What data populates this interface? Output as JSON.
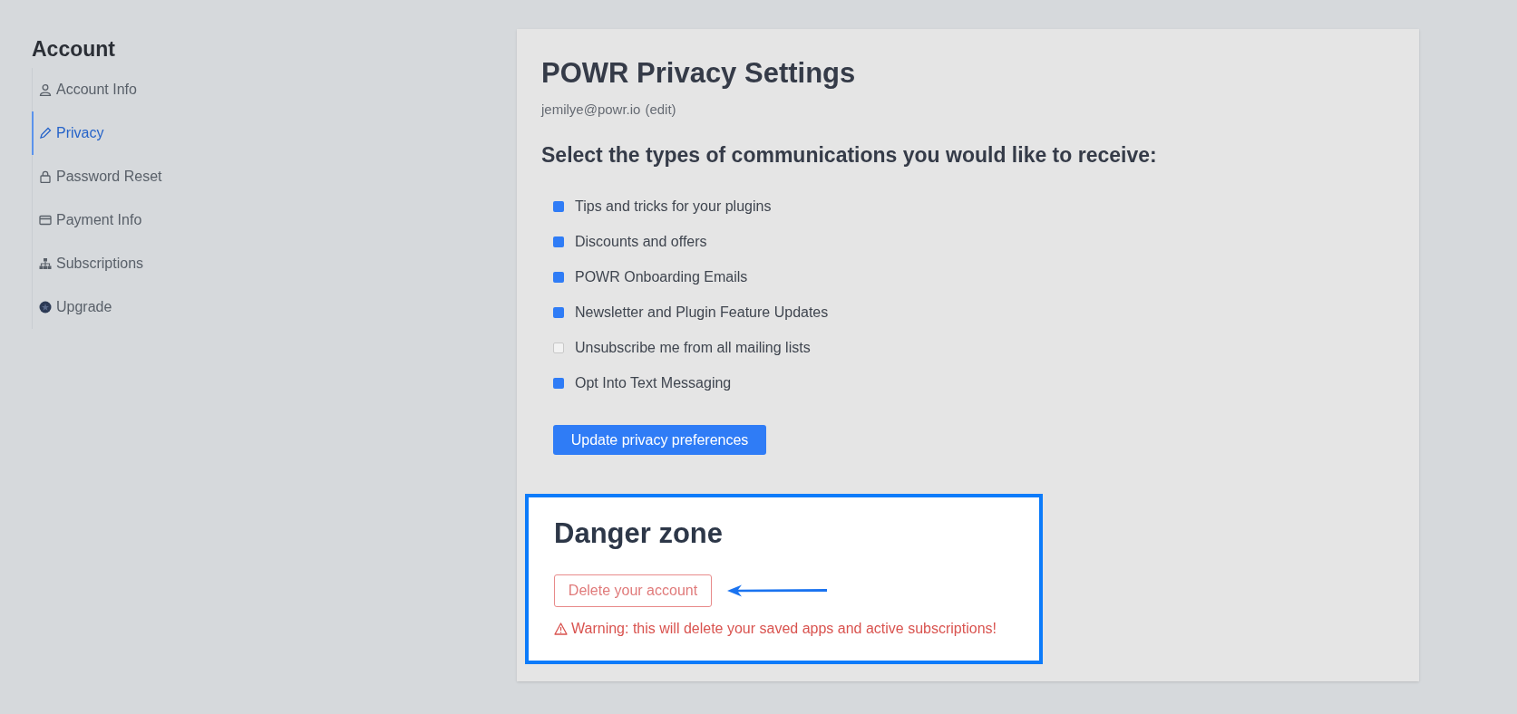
{
  "sidebar": {
    "title": "Account",
    "items": [
      {
        "label": "Account Info",
        "selected": false
      },
      {
        "label": "Privacy",
        "selected": true
      },
      {
        "label": "Password Reset",
        "selected": false
      },
      {
        "label": "Payment Info",
        "selected": false
      },
      {
        "label": "Subscriptions",
        "selected": false
      },
      {
        "label": "Upgrade",
        "selected": false
      }
    ]
  },
  "settings": {
    "title": "POWR Privacy Settings",
    "email": "jemilye@powr.io",
    "edit_link": "(edit)",
    "prompt": "Select the types of communications you would like to receive:",
    "options": [
      {
        "label": "Tips and tricks for your plugins",
        "checked": true
      },
      {
        "label": "Discounts and offers",
        "checked": true
      },
      {
        "label": "POWR Onboarding Emails",
        "checked": true
      },
      {
        "label": "Newsletter and Plugin Feature Updates",
        "checked": true
      },
      {
        "label": "Unsubscribe me from all mailing lists",
        "checked": false
      },
      {
        "label": "Opt Into Text Messaging",
        "checked": true
      }
    ],
    "button": "Update privacy preferences"
  },
  "danger_zone": {
    "title": "Danger zone",
    "button": "Delete your account",
    "warning": "Warning: this will delete your saved apps and active subscriptions!"
  }
}
